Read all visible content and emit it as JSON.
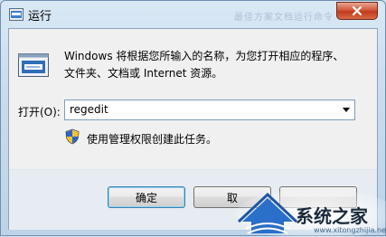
{
  "window": {
    "title": "运行",
    "ghost_title": "最佳方案文档运行命令"
  },
  "dialog": {
    "description_line1": "Windows 将根据您所输入的名称，为您打开相应的程序、",
    "description_line2": "文件夹、文档或 Internet 资源。",
    "open_label": "打开(O):",
    "open_value": "regedit",
    "admin_note": "使用管理权限创建此任务。"
  },
  "buttons": {
    "ok": "确定",
    "cancel": "取",
    "browse": ""
  },
  "watermark": {
    "brand": "系统之家",
    "url": "www.xitongzhijia.net"
  },
  "colors": {
    "close_button": "#c9472a",
    "accent_border": "#3c7fb1"
  },
  "icons": [
    "run-app-icon",
    "run-program-icon",
    "uac-shield-icon",
    "close-icon",
    "chevron-down-icon",
    "house-logo-icon"
  ]
}
